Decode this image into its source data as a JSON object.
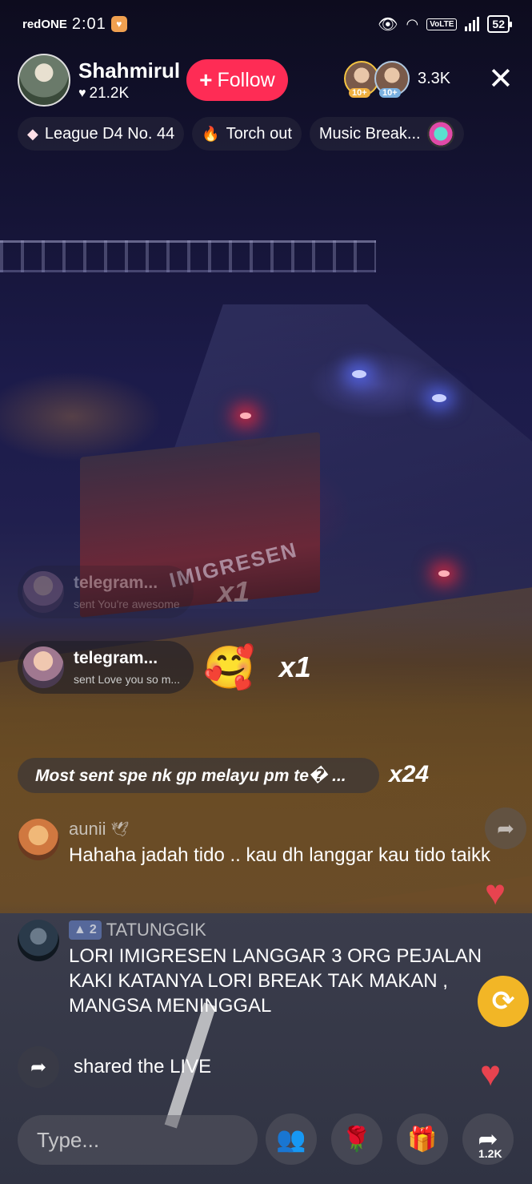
{
  "status_bar": {
    "carrier": "redONE",
    "time": "2:01",
    "volte": "VoLTE",
    "battery": "52"
  },
  "host": {
    "name": "Shahmirul",
    "likes": "21.2K",
    "follow_label": "Follow"
  },
  "viewers": {
    "badges": [
      "10+",
      "10+"
    ],
    "count": "3.3K"
  },
  "pills": {
    "league": "League D4 No. 44",
    "torch": "Torch out",
    "music": "Music Break..."
  },
  "video": {
    "truck_text": "IMIGRESEN"
  },
  "gifts": [
    {
      "user": "telegram...",
      "message": "sent You're awesome",
      "multiplier": "x1"
    },
    {
      "user": "telegram...",
      "message": "sent Love you so m...",
      "multiplier": "x1"
    }
  ],
  "most_sent": {
    "text": "Most sent spe nk gp melayu pm te� ...",
    "multiplier": "x24"
  },
  "comments": [
    {
      "user": "aunii",
      "text": "Hahaha jadah tido .. kau dh langgar kau tido taikk"
    },
    {
      "user": "TATUNGGIK",
      "rank": "2",
      "text": "LORI IMIGRESEN LANGGAR 3 ORG PEJALAN KAKI KATANYA LORI BREAK TAK MAKAN , MANGSA MENINGGAL"
    }
  ],
  "shared": {
    "text": "shared the LIVE"
  },
  "input": {
    "placeholder": "Type..."
  },
  "share_count": "1.2K",
  "colors": {
    "follow": "#fe2c55",
    "repost": "#f2b626",
    "heart": "#e8434f"
  }
}
